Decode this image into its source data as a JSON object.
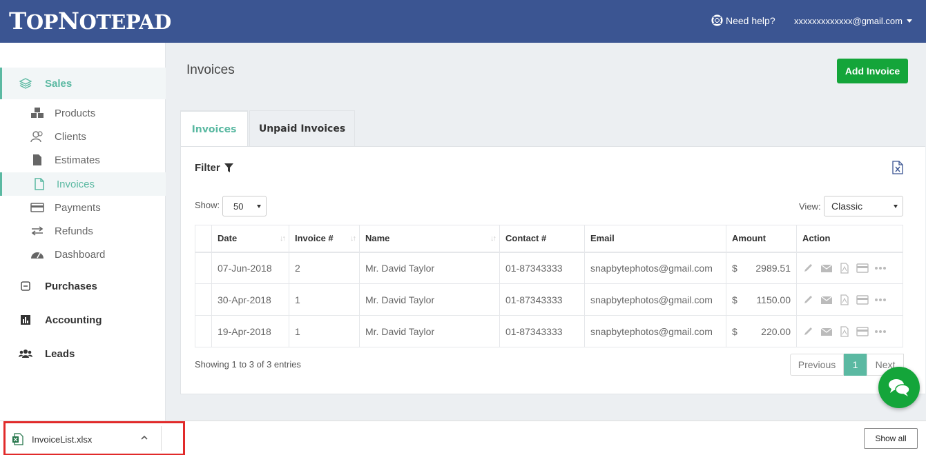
{
  "header": {
    "logo": "TopNotepad",
    "logo_parts": [
      "T",
      "OP",
      "N",
      "OTEPAD"
    ],
    "help_label": "Need help?",
    "user_email": "xxxxxxxxxxxxx@gmail.com"
  },
  "sidebar": {
    "sales": "Sales",
    "items": [
      {
        "label": "Products",
        "icon": "cubes-icon"
      },
      {
        "label": "Clients",
        "icon": "users-icon"
      },
      {
        "label": "Estimates",
        "icon": "file-icon"
      },
      {
        "label": "Invoices",
        "icon": "file-outline-icon"
      },
      {
        "label": "Payments",
        "icon": "credit-card-icon"
      },
      {
        "label": "Refunds",
        "icon": "exchange-icon"
      },
      {
        "label": "Dashboard",
        "icon": "dashboard-icon"
      }
    ],
    "purchases": "Purchases",
    "accounting": "Accounting",
    "leads": "Leads"
  },
  "main": {
    "title": "Invoices",
    "add_button": "Add Invoice",
    "tabs": [
      "Invoices",
      "Unpaid Invoices"
    ],
    "filter_label": "Filter",
    "show_label": "Show:",
    "show_value": "50",
    "view_label": "View:",
    "view_value": "Classic",
    "table": {
      "columns": [
        "Date",
        "Invoice #",
        "Name",
        "Contact #",
        "Email",
        "Amount",
        "Action"
      ],
      "rows": [
        {
          "date": "07-Jun-2018",
          "invoice": "2",
          "name": "Mr. David Taylor",
          "contact": "01-87343333",
          "email": "snapbytephotos@gmail.com",
          "currency": "$",
          "amount": "2989.51"
        },
        {
          "date": "30-Apr-2018",
          "invoice": "1",
          "name": "Mr. David Taylor",
          "contact": "01-87343333",
          "email": "snapbytephotos@gmail.com",
          "currency": "$",
          "amount": "1150.00"
        },
        {
          "date": "19-Apr-2018",
          "invoice": "1",
          "name": "Mr. David Taylor",
          "contact": "01-87343333",
          "email": "snapbytephotos@gmail.com",
          "currency": "$",
          "amount": "220.00"
        }
      ]
    },
    "entries_text": "Showing 1 to 3 of 3 entries",
    "pager": {
      "prev": "Previous",
      "page": "1",
      "next": "Next"
    }
  },
  "download_bar": {
    "file_name": "InvoiceList.xlsx",
    "show_all": "Show all"
  },
  "colors": {
    "header_bg": "#3b5592",
    "accent": "#5bb9a2",
    "primary_button": "#14a53a",
    "download_highlight": "#e12a2a"
  }
}
